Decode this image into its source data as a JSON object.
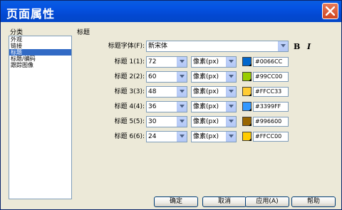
{
  "window": {
    "title": "页面属性"
  },
  "categories": {
    "label": "分类",
    "items": [
      "外观",
      "链接",
      "标题",
      "标题/编码",
      "跟踪图像"
    ],
    "selected_index": 2
  },
  "section": {
    "label": "标题"
  },
  "heading_font": {
    "label": "标题字体(F):",
    "value": "新宋体",
    "bold_label": "B",
    "italic_label": "I"
  },
  "headings": [
    {
      "label": "标题 1(1):",
      "size": "72",
      "unit": "像素(px)",
      "color": "#0066CC",
      "hex": "#0066CC"
    },
    {
      "label": "标题 2(2):",
      "size": "60",
      "unit": "像素(px)",
      "color": "#99CC00",
      "hex": "#99CC00"
    },
    {
      "label": "标题 3(3):",
      "size": "48",
      "unit": "像素(px)",
      "color": "#FFCC33",
      "hex": "#FFCC33"
    },
    {
      "label": "标题 4(4):",
      "size": "36",
      "unit": "像素(px)",
      "color": "#3399FF",
      "hex": "#3399FF"
    },
    {
      "label": "标题 5(5):",
      "size": "30",
      "unit": "像素(px)",
      "color": "#996600",
      "hex": "#996600"
    },
    {
      "label": "标题 6(6):",
      "size": "24",
      "unit": "像素(px)",
      "color": "#FFCC00",
      "hex": "#FFCC00"
    }
  ],
  "buttons": {
    "ok": "确定",
    "cancel": "取消",
    "apply": "应用(A)",
    "help": "帮助"
  }
}
